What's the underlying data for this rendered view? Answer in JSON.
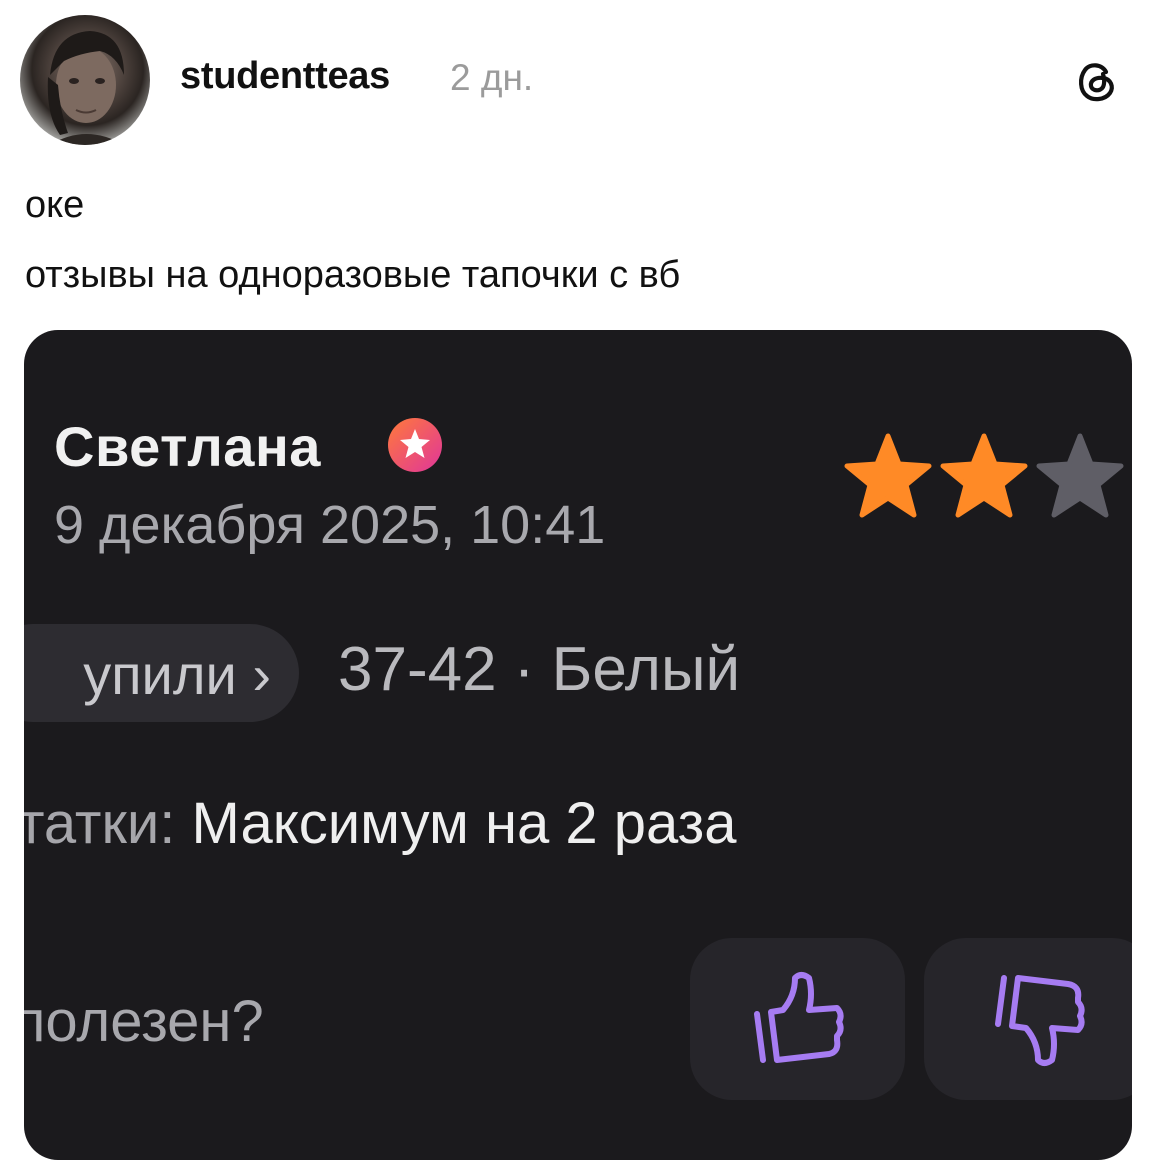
{
  "post": {
    "username": "studentteas",
    "time": "2 дн.",
    "text_line1": "оке",
    "text_line2": "отзывы на одноразовые тапочки с вб"
  },
  "review": {
    "author": "Светлана",
    "date": "9 декабря 2025, 10:41",
    "rating": 2,
    "rating_max": 3,
    "purchased_pill": "упили ›",
    "variant": "37-42 · Белый",
    "cons_label": "татки:",
    "cons_value": "Максимум на 2 раза",
    "helpful_question": "полезен?",
    "icons": {
      "badge": "star-badge-icon",
      "like": "thumbs-up-icon",
      "dislike": "thumbs-down-icon",
      "logo": "threads-logo-icon"
    },
    "colors": {
      "star_active": "#ff8a26",
      "star_inactive": "#5f5e66",
      "vote_icon": "#a67cf2",
      "badge_gradient_start": "#ff7a3a",
      "badge_gradient_end": "#e0359a"
    }
  }
}
